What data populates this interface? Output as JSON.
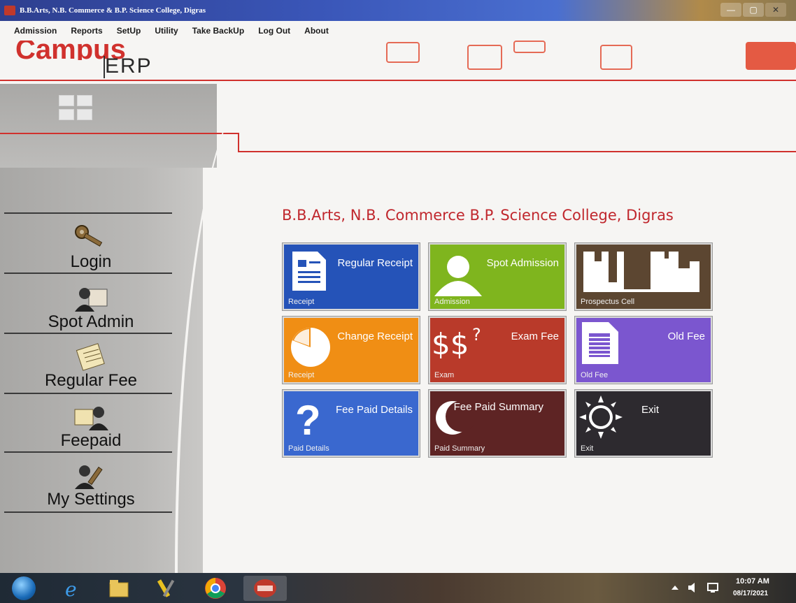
{
  "window": {
    "title": "B.B.Arts, N.B. Commerce & B.P. Science College, Digras",
    "min_icon": "—",
    "max_icon": "▢",
    "close_icon": "✕"
  },
  "menu": [
    "Admission",
    "Reports",
    "SetUp",
    "Utility",
    "Take BackUp",
    "Log Out",
    "About"
  ],
  "logo": {
    "campus": "Campus",
    "erp": "ERP"
  },
  "sidebar": {
    "items": [
      {
        "label": "Login",
        "icon": "key-icon"
      },
      {
        "label": "Spot Admin",
        "icon": "admin-user-icon"
      },
      {
        "label": "Regular Fee",
        "icon": "notepad-icon"
      },
      {
        "label": "Feepaid",
        "icon": "fee-users-icon"
      },
      {
        "label": "My Settings",
        "icon": "settings-wrench-icon"
      }
    ]
  },
  "college_title": "B.B.Arts, N.B. Commerce  B.P. Science College, Digras",
  "tiles": [
    {
      "title": "Regular Receipt",
      "sub": "Receipt",
      "color": "#2553b8",
      "icon": "document-icon"
    },
    {
      "title": "Spot Admission",
      "sub": "Admission",
      "color": "#7fb51e",
      "icon": "person-icon"
    },
    {
      "title": "",
      "sub": "Prospectus Cell",
      "color": "#5c4631",
      "icon": "prospectus-icon"
    },
    {
      "title": "Change Receipt",
      "sub": "Receipt",
      "color": "#f08e14",
      "icon": "pie-icon"
    },
    {
      "title": "Exam Fee",
      "sub": "Exam",
      "color": "#b93a2a",
      "icon": "dollar-icon"
    },
    {
      "title": "Old Fee",
      "sub": "Old Fee",
      "color": "#7b56cf",
      "icon": "list-document-icon"
    },
    {
      "title": "Fee Paid Details",
      "sub": "Paid Details",
      "color": "#3a68cf",
      "icon": "question-icon"
    },
    {
      "title": "Fee Paid Summary",
      "sub": "Paid Summary",
      "color": "#5e2424",
      "icon": "moon-icon"
    },
    {
      "title": "Exit",
      "sub": "Exit",
      "color": "#2d2a2f",
      "icon": "sun-icon"
    }
  ],
  "taskbar": {
    "time": "10:07 AM",
    "date": "08/17/2021",
    "apps": [
      "ie-icon",
      "folder-icon",
      "tools-icon",
      "chrome-icon",
      "erp-icon"
    ]
  }
}
